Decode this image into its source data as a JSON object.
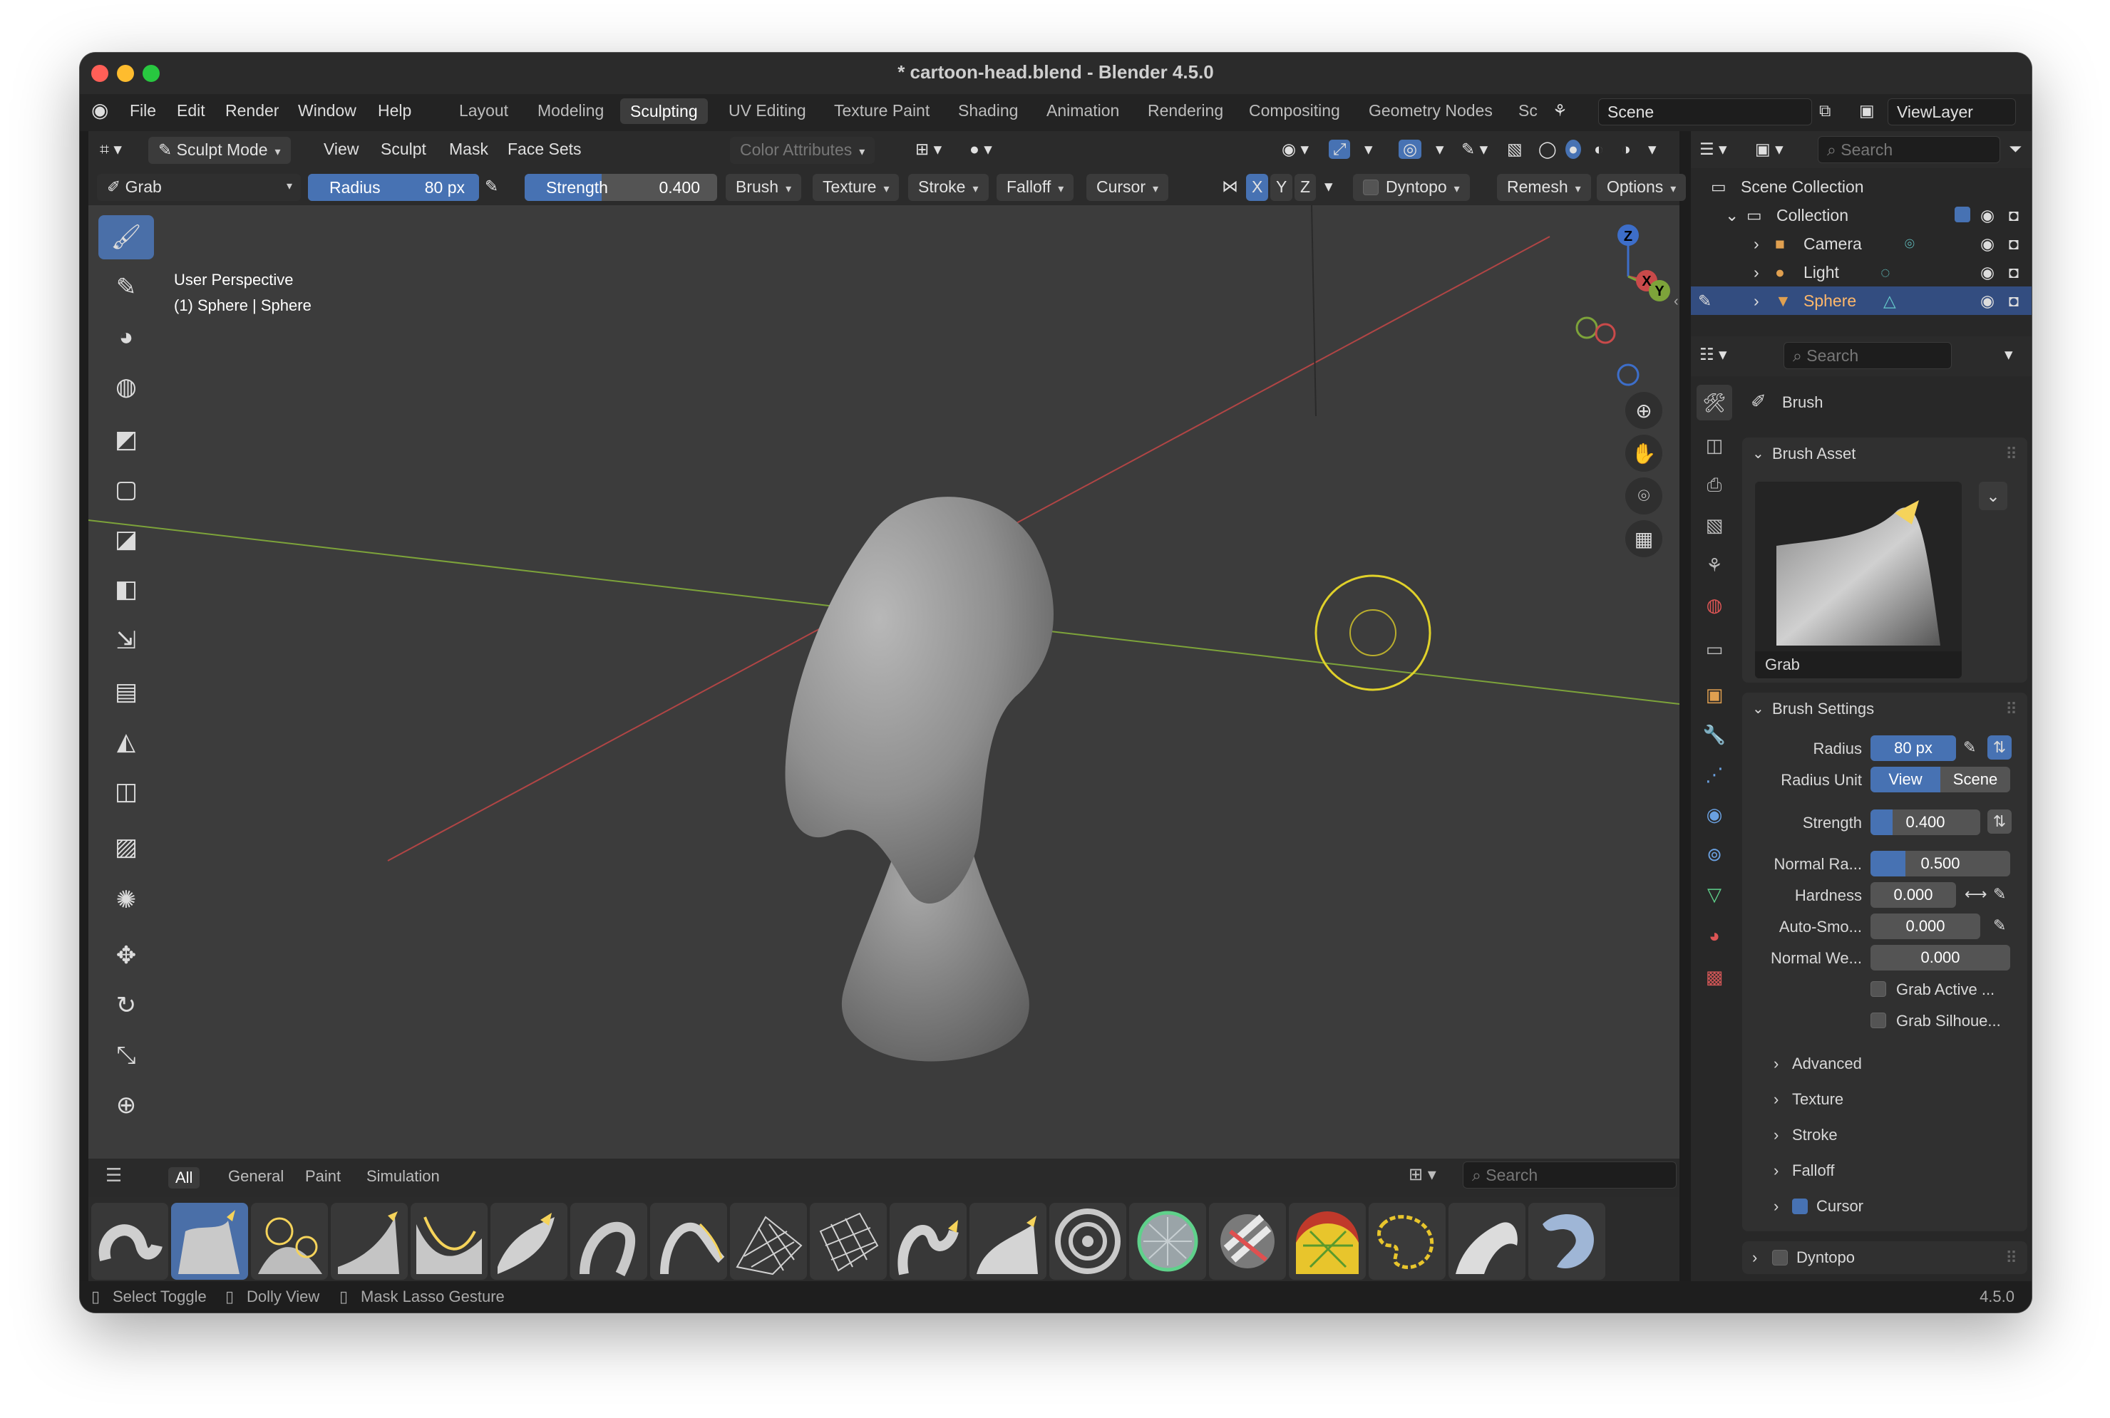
{
  "window": {
    "title": "* cartoon-head.blend - Blender 4.5.0",
    "traffic_colors": [
      "#ff5f57",
      "#febc2e",
      "#28c840"
    ]
  },
  "menu": {
    "items": [
      "File",
      "Edit",
      "Render",
      "Window",
      "Help"
    ],
    "workspaces": [
      "Layout",
      "Modeling",
      "Sculpting",
      "UV Editing",
      "Texture Paint",
      "Shading",
      "Animation",
      "Rendering",
      "Compositing",
      "Geometry Nodes",
      "Sc"
    ],
    "active_workspace": "Sculpting",
    "scene": "Scene",
    "view_layer": "ViewLayer"
  },
  "header": {
    "mode": "Sculpt Mode",
    "menus": [
      "View",
      "Sculpt",
      "Mask",
      "Face Sets"
    ],
    "color_attributes": "Color Attributes"
  },
  "tool_settings": {
    "brush": "Grab",
    "radius_label": "Radius",
    "radius_value": "80 px",
    "strength_label": "Strength",
    "strength_value": "0.400",
    "strength_fraction": 0.4,
    "dropdowns": [
      "Brush",
      "Texture",
      "Stroke",
      "Falloff",
      "Cursor"
    ],
    "axes": [
      "X",
      "Y",
      "Z"
    ],
    "dyntopo": "Dyntopo",
    "remesh": "Remesh",
    "options": "Options"
  },
  "viewport": {
    "view_name": "User Perspective",
    "object_info": "(1) Sphere | Sphere",
    "gizmo_labels": [
      "Z",
      "X",
      "Y"
    ],
    "axis_colors": {
      "x": "#c94a4a",
      "y": "#7da33a",
      "z": "#3d6ec9"
    },
    "brush_cursor_color": "#e0d12a"
  },
  "asset_shelf": {
    "tabs": [
      "All",
      "General",
      "Paint",
      "Simulation"
    ],
    "active_tab": "All",
    "search_placeholder": "Search"
  },
  "status": {
    "items": [
      "Select Toggle",
      "Dolly View",
      "Mask Lasso Gesture"
    ],
    "version": "4.5.0"
  },
  "outliner": {
    "search_placeholder": "Search",
    "root": "Scene Collection",
    "collection": "Collection",
    "objects": [
      "Camera",
      "Light",
      "Sphere"
    ],
    "selected": "Sphere"
  },
  "properties": {
    "search_placeholder": "Search",
    "context_title": "Brush",
    "brush_asset_header": "Brush Asset",
    "brush_asset_name": "Grab",
    "brush_settings_header": "Brush Settings",
    "radius_label": "Radius",
    "radius_value": "80 px",
    "radius_unit_label": "Radius Unit",
    "radius_unit_options": [
      "View",
      "Scene"
    ],
    "radius_unit_selected": "View",
    "strength_label": "Strength",
    "strength_value": "0.400",
    "strength_fraction": 0.4,
    "normal_radius_label": "Normal Ra...",
    "normal_radius_value": "0.500",
    "normal_radius_fraction": 0.5,
    "hardness_label": "Hardness",
    "hardness_value": "0.000",
    "auto_smooth_label": "Auto-Smo...",
    "auto_smooth_value": "0.000",
    "normal_weight_label": "Normal We...",
    "normal_weight_value": "0.000",
    "grab_active_label": "Grab Active ...",
    "grab_silhouette_label": "Grab Silhoue...",
    "subpanels": [
      "Advanced",
      "Texture",
      "Stroke",
      "Falloff",
      "Cursor"
    ],
    "dyntopo_label": "Dyntopo"
  }
}
